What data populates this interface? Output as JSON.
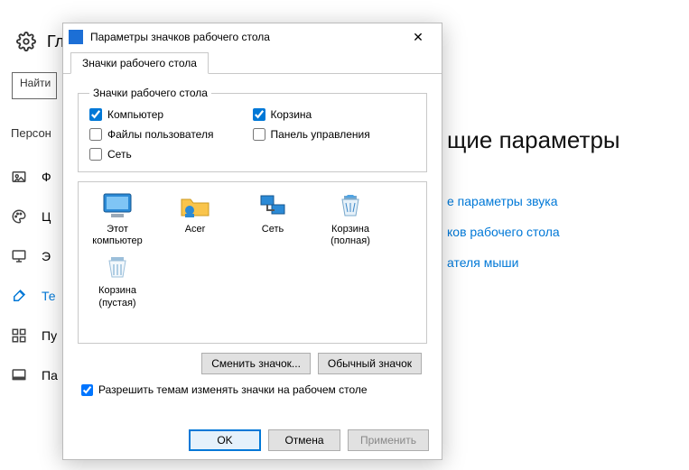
{
  "bg": {
    "header_text": "Гл",
    "search_placeholder": "Найти",
    "section_title": "Персон",
    "sidebar": [
      {
        "label": "Ф"
      },
      {
        "label": "Ц"
      },
      {
        "label": "Э"
      },
      {
        "label": "Те",
        "selected": true
      },
      {
        "label": "Пу"
      },
      {
        "label": "Пa"
      }
    ],
    "right_heading": "щие параметры",
    "links": [
      "е параметры звука",
      "ков рабочего стола",
      "ателя мыши"
    ]
  },
  "dialog": {
    "title": "Параметры значков рабочего стола",
    "close": "✕",
    "tab": "Значки рабочего стола",
    "group_legend": "Значки рабочего стола",
    "checkboxes": {
      "computer": {
        "label": "Компьютер",
        "checked": true
      },
      "recycle": {
        "label": "Корзина",
        "checked": true
      },
      "userfiles": {
        "label": "Файлы пользователя",
        "checked": false
      },
      "cpanel": {
        "label": "Панель управления",
        "checked": false
      },
      "network": {
        "label": "Сеть",
        "checked": false
      }
    },
    "icons": [
      {
        "name": "this-pc",
        "label": "Этот компьютер"
      },
      {
        "name": "acer",
        "label": "Acer"
      },
      {
        "name": "network",
        "label": "Сеть"
      },
      {
        "name": "recycle-full",
        "label": "Корзина (полная)"
      },
      {
        "name": "recycle-empty",
        "label": "Корзина (пустая)"
      }
    ],
    "buttons": {
      "change_icon": "Сменить значок...",
      "default_icon": "Обычный значок"
    },
    "allow_themes": {
      "label": "Разрешить темам изменять значки на рабочем столе",
      "checked": true
    },
    "footer": {
      "ok": "OK",
      "cancel": "Отмена",
      "apply": "Применить"
    }
  }
}
